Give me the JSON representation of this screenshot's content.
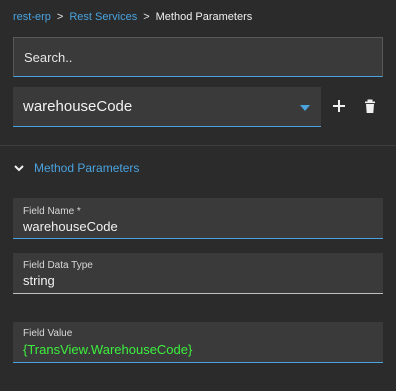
{
  "breadcrumb": {
    "items": [
      {
        "label": "rest-erp"
      },
      {
        "label": "Rest Services"
      },
      {
        "label": "Method Parameters"
      }
    ],
    "separator": ">"
  },
  "search": {
    "placeholder": "Search..",
    "value": ""
  },
  "parameter_select": {
    "value": "warehouseCode"
  },
  "toolbar": {
    "add_icon": "plus-icon",
    "delete_icon": "trash-icon"
  },
  "section": {
    "title": "Method Parameters",
    "expanded": true
  },
  "fields": {
    "field_name": {
      "label": "Field Name *",
      "value": "warehouseCode"
    },
    "field_data_type": {
      "label": "Field Data Type",
      "value": "string"
    },
    "field_value": {
      "label": "Field Value",
      "value": "{TransView.WarehouseCode}"
    }
  },
  "colors": {
    "accent": "#4aa3df",
    "background": "#2b2b2b",
    "input_bg": "#3a3a3a",
    "highlight_text": "#3df03d"
  }
}
